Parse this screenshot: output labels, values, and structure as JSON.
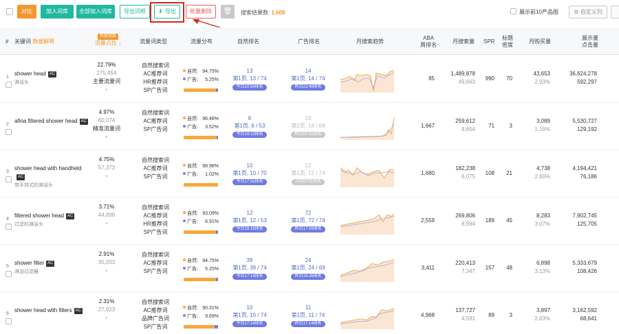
{
  "toolbar": {
    "compare": "对比",
    "add_to_library": "加入词库",
    "add_all_to_library": "全部加入词库",
    "export_root": "导出词根",
    "export": "导出",
    "batch_delete": "批量删除",
    "result_label": "搜索结果数:",
    "result_count": "1,608",
    "show_top10": "展示前10产品图",
    "custom_columns": "自定义列"
  },
  "header": {
    "idx": "#",
    "keyword": "关键词",
    "keyword_sub": "数据解释",
    "ratio_badge": "热度指数",
    "ratio": "流量占比",
    "type": "流量词类型",
    "dist": "流量分布",
    "natural": "自然排名",
    "ad": "广告排名",
    "trend": "月搜索趋势",
    "aba": "ABA",
    "aba2": "周排名",
    "msv": "月搜索量",
    "spr": "SPR",
    "title_density": "标题",
    "title_density2": "密度",
    "monthly_sales": "月购买量",
    "impr": "展示量",
    "impr2": "点击量"
  },
  "rows": [
    {
      "idx": "1",
      "kw": "shower head",
      "ac": "AC",
      "kw_cn": "淋浴头",
      "pct": "22.79%",
      "vol": "275,454",
      "tag": "主要流量词",
      "dash": "-",
      "types": [
        "自然搜索词",
        "AC推荐词",
        "HR推荐词",
        "SP广告词"
      ],
      "nat_lbl": "自然:",
      "nat": "94.75%",
      "ad_lbl": "广告:",
      "ad": "5.25%",
      "nat_n": "13",
      "nat_p": "第1页, 13 / 74",
      "nat_t": "今日20:54排名",
      "ad_n": "14",
      "ad_p": "第1页, 14 / 74",
      "ad_t": "昨日22:49排名",
      "aba": "85",
      "msv": "1,489,878",
      "msv2": "49,663",
      "spr": "990",
      "density": "70",
      "sales": "43,653",
      "sales_pct": "2.93%",
      "impr": "36,624,278",
      "clicks": "592,297",
      "ad_share": 0.0525,
      "ad_grey": false
    },
    {
      "idx": "2",
      "kw": "afina filtered shower head",
      "ac": "AC",
      "kw_cn": "",
      "pct": "4.97%",
      "vol": "60,074",
      "tag": "精准流量词",
      "dash": "-",
      "types": [
        "自然搜索词",
        "AC推荐词",
        "SP广告词"
      ],
      "nat_lbl": "自然:",
      "nat": "96.48%",
      "ad_lbl": "广告:",
      "ad": "3.52%",
      "nat_n": "6",
      "nat_p": "第1页, 6 / 53",
      "nat_t": "今日19:13排名",
      "ad_n": "18",
      "ad_p": "第1页, 18 / 68",
      "ad_t": "昨日07:51排名",
      "aba": "1,667",
      "msv": "259,612",
      "msv2": "8,654",
      "spr": "71",
      "density": "3",
      "sales": "3,089",
      "sales_pct": "1.19%",
      "impr": "5,530,727",
      "clicks": "129,192",
      "ad_share": 0.0352,
      "ad_grey": true
    },
    {
      "idx": "3",
      "kw": "shower head with handheld",
      "ac": "AC",
      "kw_cn": "带手持式的淋浴头",
      "pct": "4.75%",
      "vol": "57,373",
      "tag": "",
      "dash": "-",
      "types": [
        "自然搜索词",
        "AC推荐词",
        "SP广告词"
      ],
      "nat_lbl": "自然:",
      "nat": "98.98%",
      "ad_lbl": "广告:",
      "ad": "1.02%",
      "nat_n": "10",
      "nat_p": "第1页, 10 / 70",
      "nat_t": "今日17:52排名",
      "ad_n": "12",
      "ad_p": "第1页, 12 / 74",
      "ad_t": "03月07日排名",
      "aba": "1,680",
      "msv": "182,238",
      "msv2": "6,075",
      "spr": "108",
      "density": "21",
      "sales": "4,738",
      "sales_pct": "2.60%",
      "impr": "4,194,421",
      "clicks": "76,186",
      "ad_share": 0.0102,
      "ad_grey": true
    },
    {
      "idx": "4",
      "kw": "filtered shower head",
      "ac": "AC",
      "kw_cn": "过滤的淋浴头",
      "pct": "3.71%",
      "vol": "44,898",
      "tag": "",
      "dash": "-",
      "types": [
        "自然搜索词",
        "AC推荐词",
        "HR推荐词",
        "SP广告词"
      ],
      "nat_lbl": "自然:",
      "nat": "93.09%",
      "ad_lbl": "广告:",
      "ad": "6.91%",
      "nat_n": "12",
      "nat_p": "第1页, 12 / 53",
      "nat_t": "今日19:16排名",
      "ad_n": "72",
      "ad_p": "第1页, 72 / 74",
      "ad_t": "昨日17:09排名",
      "aba": "2,559",
      "msv": "269,806",
      "msv2": "8,994",
      "spr": "189",
      "density": "45",
      "sales": "8,283",
      "sales_pct": "3.07%",
      "impr": "7,902,745",
      "clicks": "125,705",
      "ad_share": 0.0691,
      "ad_grey": false
    },
    {
      "idx": "5",
      "kw": "shower filter",
      "ac": "AC",
      "kw_cn": "淋浴过滤器",
      "pct": "2.91%",
      "vol": "35,203",
      "tag": "",
      "dash": "-",
      "types": [
        "自然搜索词",
        "AC推荐词",
        "SP广告词"
      ],
      "nat_lbl": "自然:",
      "nat": "94.75%",
      "ad_lbl": "广告:",
      "ad": "5.25%",
      "nat_n": "39",
      "nat_p": "第1页, 39 / 74",
      "nat_t": "今日17:14排名",
      "ad_n": "24",
      "ad_p": "第1页, 24 / 69",
      "ad_t": "昨日19:26排名",
      "aba": "3,411",
      "msv": "220,413",
      "msv2": "7,347",
      "spr": "157",
      "density": "48",
      "sales": "6,898",
      "sales_pct": "3.13%",
      "impr": "5,333,679",
      "clicks": "108,426",
      "ad_share": 0.0525,
      "ad_grey": false
    },
    {
      "idx": "6",
      "kw": "shower head with filters",
      "ac": "AC",
      "kw_cn": "",
      "pct": "2.31%",
      "vol": "27,923",
      "tag": "",
      "dash": "-",
      "types": [
        "自然搜索词",
        "AC推荐词",
        "品牌广告词",
        "SP广告词"
      ],
      "nat_lbl": "自然:",
      "nat": "90.31%",
      "ad_lbl": "广告:",
      "ad": "9.69%",
      "nat_n": "10",
      "nat_p": "第1页, 10 / 74",
      "nat_t": "今日17:14排名",
      "ad_n": "11",
      "ad_p": "第1页, 11 / 74",
      "ad_t": "昨日17:14排名",
      "aba": "4,968",
      "msv": "137,727",
      "msv2": "4,591",
      "spr": "89",
      "density": "3",
      "sales": "3,897",
      "sales_pct": "2.83%",
      "impr": "3,162,592",
      "clicks": "68,641",
      "ad_share": 0.0969,
      "ad_grey": false
    }
  ],
  "colors": {
    "accent_orange": "#f5962e",
    "accent_teal": "#20b8a0",
    "rank_blue": "#5068c8",
    "highlight_red": "#d9241c"
  }
}
